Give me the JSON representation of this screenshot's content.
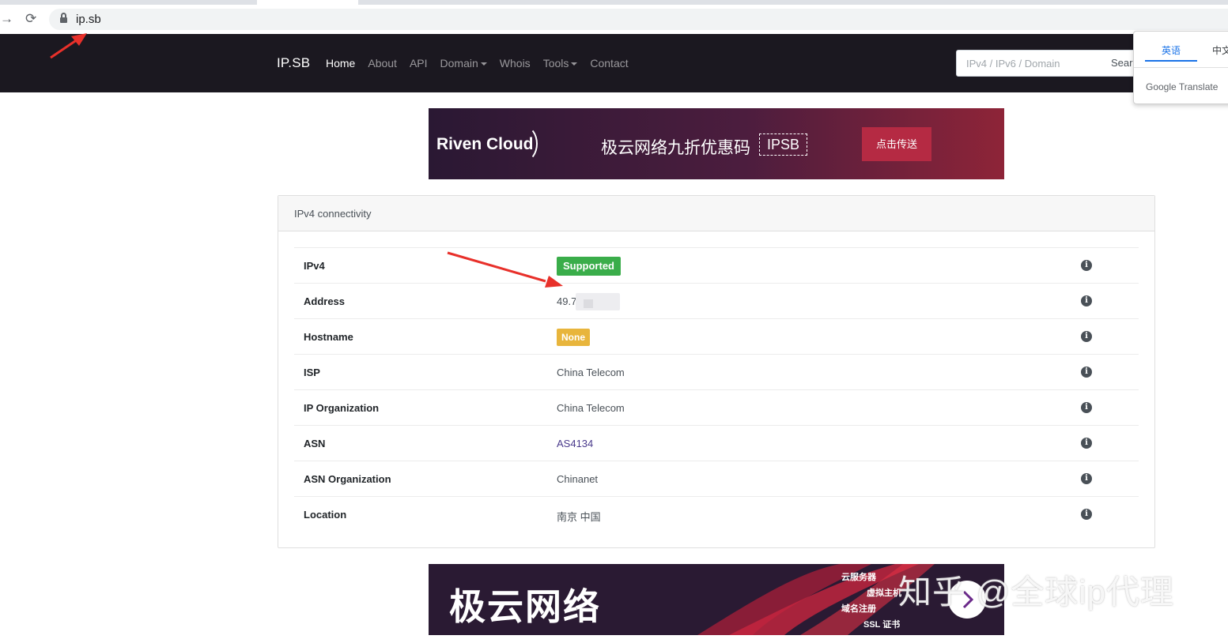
{
  "browser": {
    "back_icon": "arrow-right-icon",
    "reload_icon": "reload-icon",
    "url": "ip.sb"
  },
  "navbar": {
    "brand": "IP.SB",
    "links": [
      "Home",
      "About",
      "API",
      "Domain",
      "Whois",
      "Tools",
      "Contact"
    ],
    "active": "Home",
    "dropdowns": [
      "Domain",
      "Tools"
    ],
    "search_placeholder": "IPv4 / IPv6 / Domain",
    "search_button": "Search",
    "background": "#1b1820"
  },
  "translate_popup": {
    "tab_source": "英语",
    "tab_target": "中文",
    "brand": "Google Translate",
    "accent": "#1a73e8"
  },
  "banner_top": {
    "logo": "Riven Cloud",
    "promo": "极云网络九折优惠码",
    "code": "IPSB",
    "button": "点击传送"
  },
  "card": {
    "title": "IPv4 connectivity",
    "rows": [
      {
        "label": "IPv4",
        "value": "Supported",
        "type": "badge-success"
      },
      {
        "label": "Address",
        "value": "49.7",
        "type": "text-redacted"
      },
      {
        "label": "Hostname",
        "value": "None",
        "type": "badge-warning"
      },
      {
        "label": "ISP",
        "value": "China Telecom",
        "type": "text"
      },
      {
        "label": "IP Organization",
        "value": "China Telecom",
        "type": "text"
      },
      {
        "label": "ASN",
        "value": "AS4134",
        "type": "link"
      },
      {
        "label": "ASN Organization",
        "value": "Chinanet",
        "type": "text"
      },
      {
        "label": "Location",
        "value": "南京 中国",
        "type": "text"
      }
    ],
    "row_icon": "info-icon"
  },
  "banner_bottom": {
    "logo": "极云网络",
    "services": [
      "云服务器",
      "虚拟主机",
      "域名注册",
      "SSL 证书"
    ]
  },
  "watermark": "知乎 @全球ip代理",
  "colors": {
    "success": "#3aad4a",
    "warning": "#e8b53c",
    "annotation_arrow": "#e8302a"
  }
}
